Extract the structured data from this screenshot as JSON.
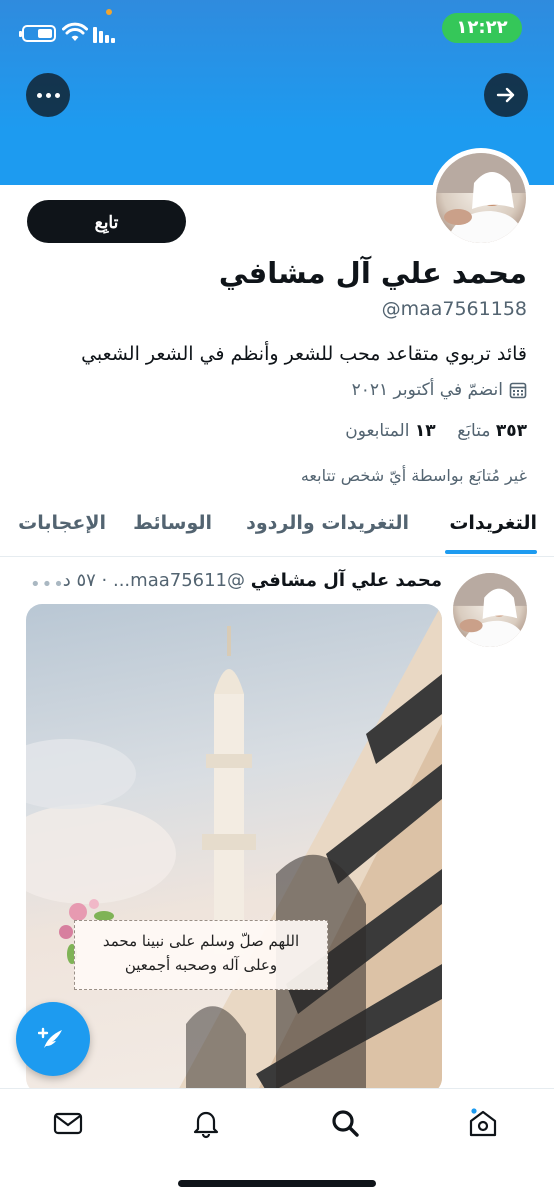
{
  "status_bar": {
    "time": "١٢:٢٢"
  },
  "header": {
    "more_icon": "more-horizontal-icon",
    "back_icon": "arrow-right-icon",
    "banner_color": "#1d9bf0"
  },
  "profile": {
    "follow_label": "تابِع",
    "name": "محمد علي آل مشافي",
    "handle": "@maa7561158",
    "bio": "قائد تربوي متقاعد محب للشعر وأنظم في الشعر الشعبي",
    "joined": "انضمّ في أكتوبر ٢٠٢١",
    "following_count": "٣٥٣",
    "following_label": "متابَع",
    "followers_count": "١٣",
    "followers_label": "المتابعون",
    "not_followed_note": "غير مُتابَع بواسطة أيّ شخص تتابعه"
  },
  "tabs": [
    {
      "label": "التغريدات",
      "active": true
    },
    {
      "label": "التغريدات والردود",
      "active": false
    },
    {
      "label": "الوسائط",
      "active": false
    },
    {
      "label": "الإعجابات",
      "active": false
    }
  ],
  "tweet": {
    "author": "محمد علي آل مشافي",
    "handle": "@maa75611...",
    "time": "٥٧ د",
    "separator": "·",
    "image_caption_line1": "اللهم صلّ وسلم على نبينا محمد",
    "image_caption_line2": "وعلى آله وصحبه أجمعين"
  },
  "fab": {
    "icon": "compose-tweet-icon"
  },
  "bottom_nav": [
    {
      "icon": "messages-icon"
    },
    {
      "icon": "notifications-icon"
    },
    {
      "icon": "search-icon"
    },
    {
      "icon": "home-icon"
    }
  ],
  "colors": {
    "accent": "#1d9bf0",
    "text": "#0f1419",
    "muted": "#536471",
    "status_green": "#35c759"
  }
}
